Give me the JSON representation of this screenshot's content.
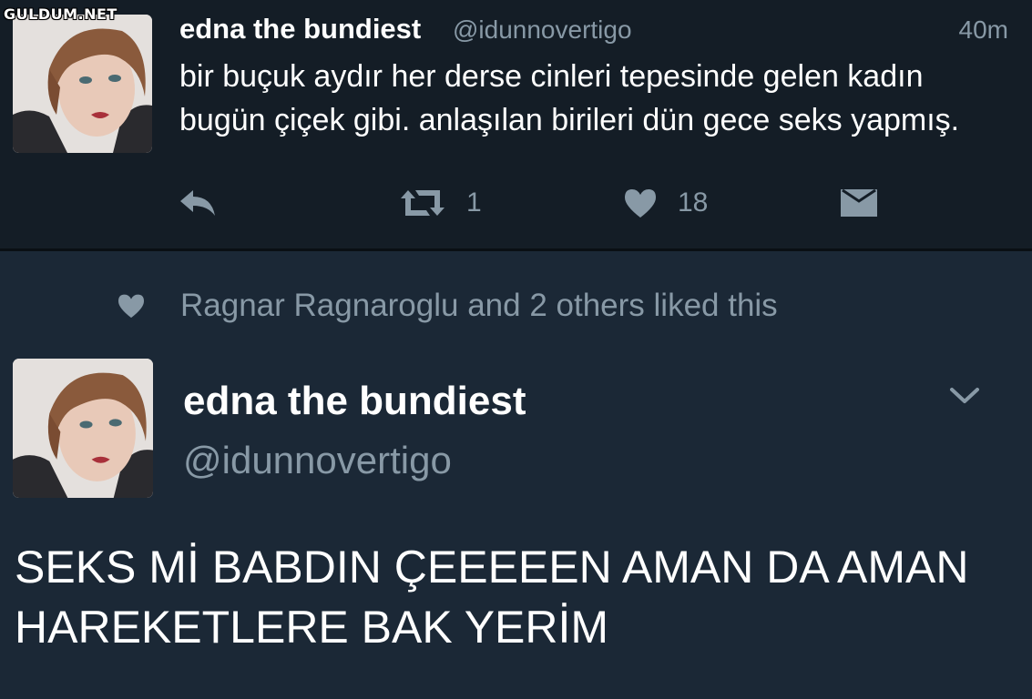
{
  "watermark": "GULDUM.NET",
  "tweet1": {
    "author_name": "edna the bundiest",
    "author_handle": "@idunnovertigo",
    "time": "40m",
    "text": "bir buçuk aydır her derse cinleri tepesinde gelen kadın bugün çiçek gibi. anlaşılan birileri dün gece seks yapmış.",
    "retweet_count": "1",
    "like_count": "18",
    "icons": {
      "reply": "reply-icon",
      "retweet": "retweet-icon",
      "like": "heart-icon",
      "dm": "envelope-icon"
    }
  },
  "tweet2": {
    "social_context": "Ragnar Ragnaroglu and 2 others liked this",
    "author_name": "edna the bundiest",
    "author_handle": "@idunnovertigo",
    "text": "SEKS Mİ BABDIN ÇEEEEEN AMAN DA AMAN HAREKETLERE BAK YERİM",
    "icons": {
      "social": "heart-icon",
      "menu": "chevron-down-icon"
    }
  },
  "colors": {
    "background_top": "#141d26",
    "background_bottom": "#1b2836",
    "text_primary": "#ffffff",
    "text_secondary": "#8899a6"
  }
}
